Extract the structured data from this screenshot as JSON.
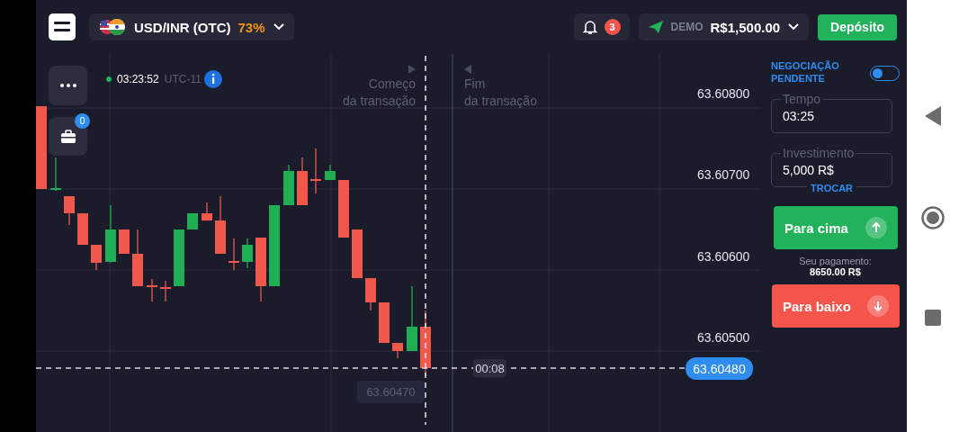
{
  "header": {
    "asset": {
      "pair": "USD/INR (OTC)",
      "payout": "73%"
    },
    "notifications": {
      "count": "3"
    },
    "account": {
      "mode": "DEMO",
      "balance": "R$1,500.00"
    },
    "deposit_button": "Depósito"
  },
  "chart": {
    "clock": "03:23:52",
    "timezone": "UTC-11",
    "portfolio_count": "0",
    "start_label": "Começo\nda transação",
    "end_label": "Fim\nda transação",
    "price_ticks": [
      "63.60800",
      "63.60700",
      "63.60600",
      "63.60500"
    ],
    "countdown": "00:08",
    "current_price": "63.60480",
    "cursor_price": "63.60470"
  },
  "trade_panel": {
    "pending": {
      "label": "NEGOCIAÇÃO PENDENTE",
      "on": false
    },
    "time": {
      "label": "Tempo",
      "value": "03:25"
    },
    "investment": {
      "label": "Investimento",
      "value": "5,000 R$",
      "switch": "TROCAR"
    },
    "up_button": "Para cima",
    "payout_label": "Seu pagamento:",
    "payout_value": "8650.00 R$",
    "down_button": "Para baixo"
  }
}
